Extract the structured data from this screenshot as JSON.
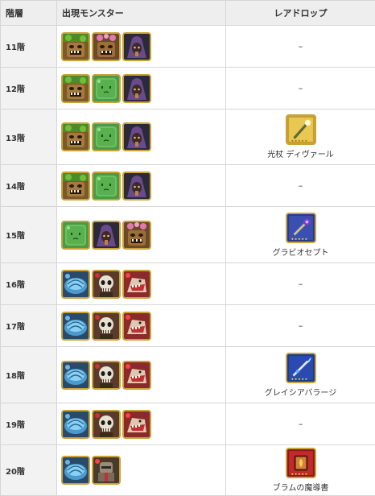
{
  "header": {
    "floor": "階層",
    "monsters": "出現モンスター",
    "rare_drop": "レアドロップ"
  },
  "rows": [
    {
      "floor": "11階",
      "monsters": [
        "wood-treant-icon",
        "pink-treant-icon",
        "purple-witch-icon"
      ],
      "drop": null,
      "dash": "–"
    },
    {
      "floor": "12階",
      "monsters": [
        "wood-treant-icon",
        "green-slime-icon",
        "purple-witch-icon"
      ],
      "drop": null,
      "dash": "–"
    },
    {
      "floor": "13階",
      "monsters": [
        "wood-treant-icon",
        "green-slime-icon",
        "purple-witch-icon"
      ],
      "drop": {
        "icon": "light-staff-icon",
        "name": "光杖 ディヴァール"
      }
    },
    {
      "floor": "14階",
      "monsters": [
        "wood-treant-icon",
        "green-slime-icon",
        "purple-witch-icon"
      ],
      "drop": null,
      "dash": "–"
    },
    {
      "floor": "15階",
      "monsters": [
        "green-slime-icon",
        "purple-witch-icon",
        "pink-treant-icon"
      ],
      "drop": {
        "icon": "dark-scepter-icon",
        "name": "グラビオセプト"
      }
    },
    {
      "floor": "16階",
      "monsters": [
        "blue-shell-icon",
        "skeleton-icon",
        "red-beast-icon"
      ],
      "drop": null,
      "dash": "–"
    },
    {
      "floor": "17階",
      "monsters": [
        "blue-shell-icon",
        "skeleton-icon",
        "red-beast-icon"
      ],
      "drop": null,
      "dash": "–"
    },
    {
      "floor": "18階",
      "monsters": [
        "blue-shell-icon",
        "skeleton-icon",
        "red-beast-icon"
      ],
      "drop": {
        "icon": "ice-spear-icon",
        "name": "グレイシアバラージ"
      }
    },
    {
      "floor": "19階",
      "monsters": [
        "blue-shell-icon",
        "skeleton-icon",
        "red-beast-icon"
      ],
      "drop": null,
      "dash": "–"
    },
    {
      "floor": "20階",
      "monsters": [
        "blue-shell-icon",
        "armored-knight-icon"
      ],
      "drop": {
        "icon": "fire-tome-icon",
        "name": "ブラムの魔導書"
      }
    }
  ]
}
